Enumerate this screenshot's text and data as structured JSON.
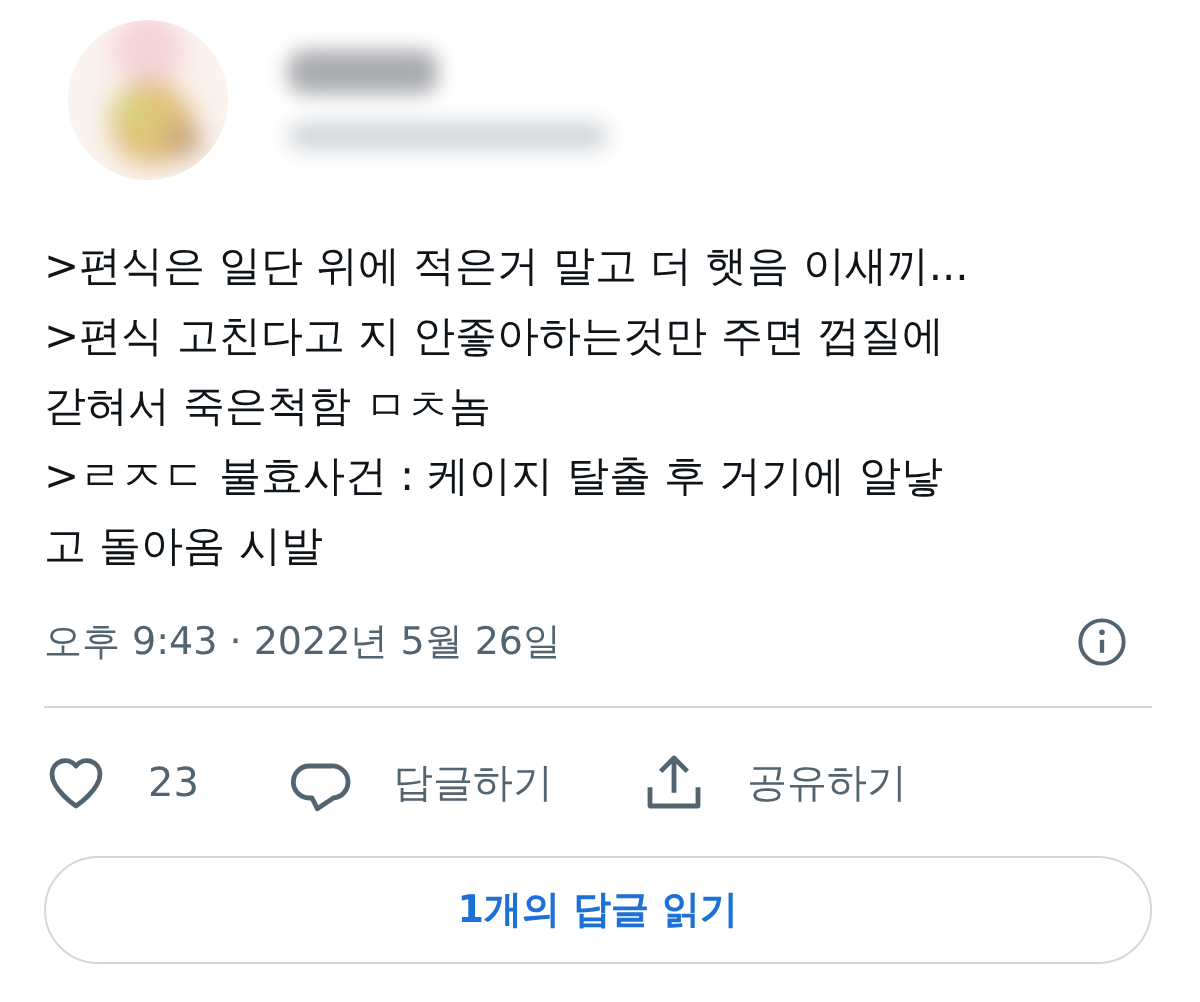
{
  "tweet": {
    "lines": [
      ">편식은 일단 위에 적은거 말고 더 햇음 이새끼...",
      ">편식 고친다고 지 안좋아하는것만 주면 껍질에",
      "갇혀서 죽은척함 ㅁㅊ놈",
      ">ㄹㅈㄷ 불효사건 : 케이지 탈출 후 거기에 알낳",
      "고 돌아옴 시발"
    ],
    "timestamp": "오후 9:43 · 2022년 5월 26일",
    "actions": [
      {
        "kind": "like",
        "label": "23"
      },
      {
        "kind": "reply",
        "label": "답글하기"
      },
      {
        "kind": "share",
        "label": "공유하기"
      }
    ],
    "read_replies_button": "1개의 답글 읽기"
  }
}
